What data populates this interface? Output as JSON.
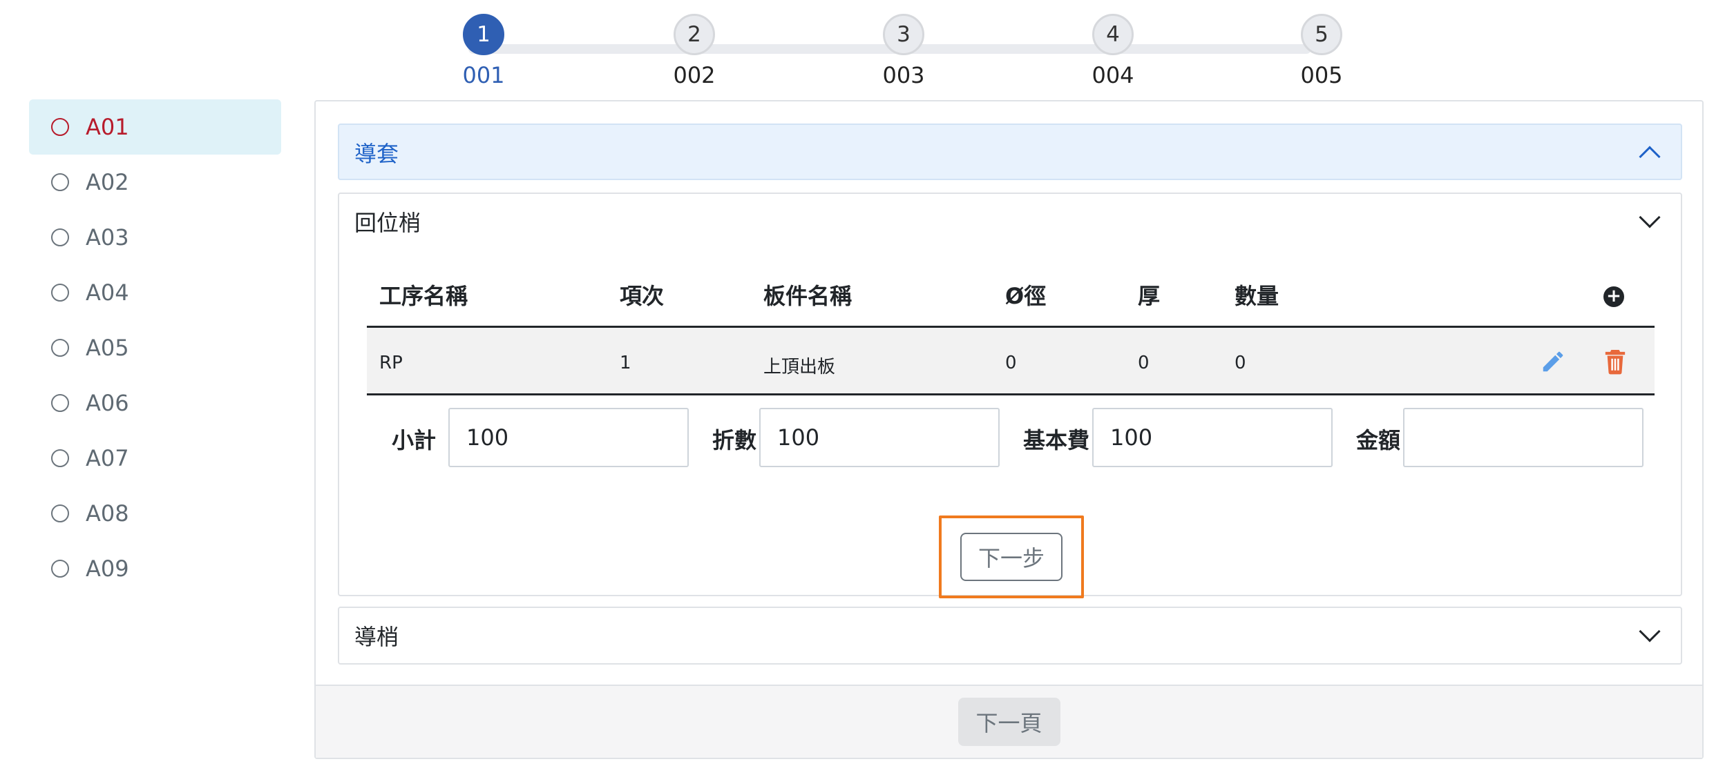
{
  "sidebar": {
    "items": [
      {
        "label": "A01",
        "active": true
      },
      {
        "label": "A02",
        "active": false
      },
      {
        "label": "A03",
        "active": false
      },
      {
        "label": "A04",
        "active": false
      },
      {
        "label": "A05",
        "active": false
      },
      {
        "label": "A06",
        "active": false
      },
      {
        "label": "A07",
        "active": false
      },
      {
        "label": "A08",
        "active": false
      },
      {
        "label": "A09",
        "active": false
      }
    ]
  },
  "stepper": {
    "steps": [
      {
        "number": "1",
        "label": "001",
        "active": true
      },
      {
        "number": "2",
        "label": "002",
        "active": false
      },
      {
        "number": "3",
        "label": "003",
        "active": false
      },
      {
        "number": "4",
        "label": "004",
        "active": false
      },
      {
        "number": "5",
        "label": "005",
        "active": false
      }
    ]
  },
  "panels": {
    "guide_sleeve": {
      "title": "導套",
      "expanded": true
    },
    "return_pin": {
      "title": "回位梢",
      "expanded": true
    },
    "guide_pin": {
      "title": "導梢",
      "expanded": false
    }
  },
  "table": {
    "headers": [
      "工序名稱",
      "項次",
      "板件名稱",
      "Ø徑",
      "厚",
      "數量"
    ],
    "rows": [
      [
        "RP",
        "1",
        "上頂出板",
        "0",
        "0",
        "0"
      ]
    ]
  },
  "summary": {
    "subtotal_label": "小計",
    "subtotal_value": "100",
    "discount_label": "折數",
    "discount_value": "100",
    "base_fee_label": "基本費",
    "base_fee_value": "100",
    "amount_label": "金額",
    "amount_value": ""
  },
  "buttons": {
    "next_step": "下一步",
    "next_page": "下一頁"
  },
  "colors": {
    "accent_blue": "#2f5fb3",
    "active_red": "#b71c2c",
    "highlight_orange": "#f07a1e",
    "edit_blue": "#5b9ee8",
    "trash_orange": "#e8693c"
  }
}
